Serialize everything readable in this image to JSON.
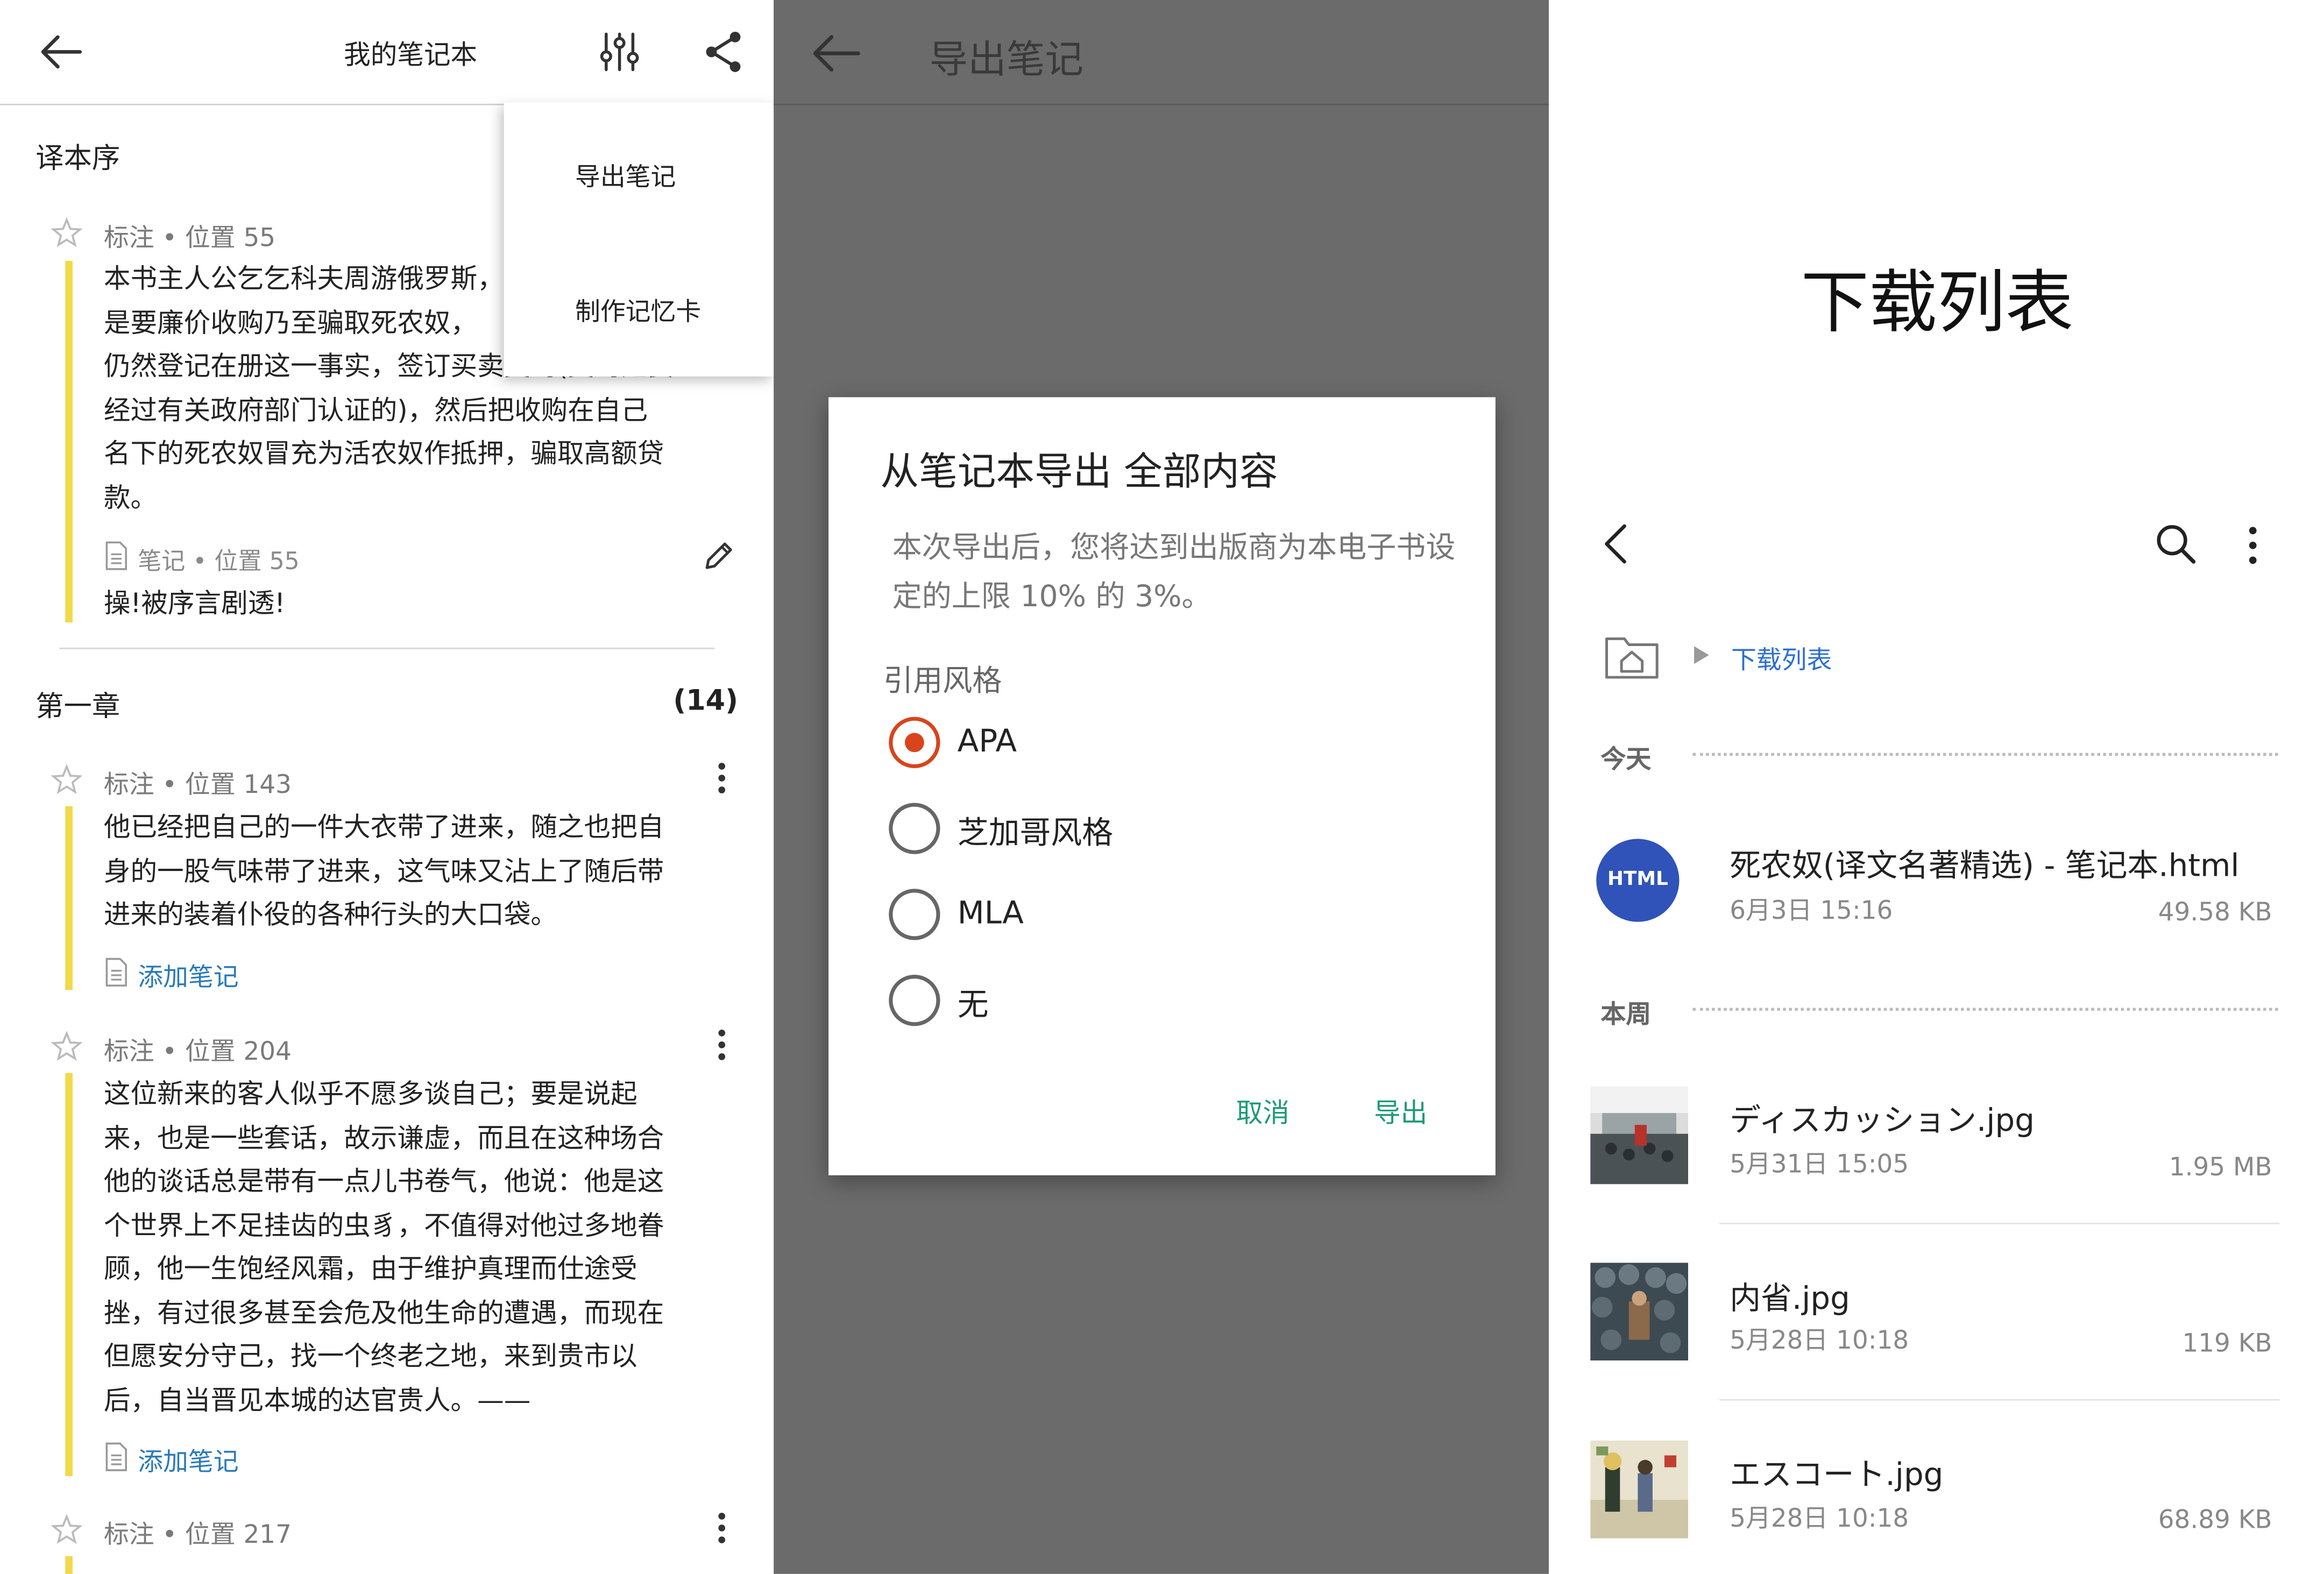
{
  "notebook": {
    "header": {
      "title": "我的笔记本",
      "icons": [
        "back-arrow-icon",
        "filter-sliders-icon",
        "share-icon"
      ]
    },
    "menu": {
      "items": [
        "导出笔记",
        "制作记忆卡"
      ]
    },
    "sections": [
      {
        "title": "译本序",
        "annotations": [
          {
            "meta": "标注 • 位置 55",
            "lines": [
              "本书主人公乞乞科夫周游俄罗斯，",
              "是要廉价收购乃至骗取死农奴，",
              "仍然登记在册这一事实，签订买卖契约(契约是要",
              "经过有关政府部门认证的)，然后把收购在自己",
              "名下的死农奴冒充为活农奴作抵押，骗取高额贷",
              "款。"
            ],
            "note_meta": "笔记 • 位置 55",
            "note_text": "操!被序言剧透!"
          }
        ]
      },
      {
        "title": "第一章",
        "count": "(14)",
        "annotations": [
          {
            "meta": "标注 • 位置 143",
            "lines": [
              "他已经把自己的一件大衣带了进来，随之也把自",
              "身的一股气味带了进来，这气味又沾上了随后带",
              "进来的装着仆役的各种行头的大口袋。"
            ],
            "add_note": "添加笔记"
          },
          {
            "meta": "标注 • 位置 204",
            "lines": [
              "这位新来的客人似乎不愿多谈自己；要是说起",
              "来，也是一些套话，故示谦虚，而且在这种场合",
              "他的谈话总是带有一点儿书卷气，他说：他是这",
              "个世界上不足挂齿的虫豸，不值得对他过多地眷",
              "顾，他一生饱经风霜，由于维护真理而仕途受",
              "挫，有过很多甚至会危及他生命的遭遇，而现在",
              "但愿安分守己，找一个终老之地，来到贵市以",
              "后，自当晋见本城的达官贵人。——"
            ],
            "add_note": "添加笔记"
          },
          {
            "meta": "标注 • 位置 217",
            "lines": [
              "……"
            ]
          }
        ]
      }
    ]
  },
  "export": {
    "header": {
      "title": "导出笔记"
    },
    "dialog": {
      "title": "从笔记本导出 全部内容",
      "body": "本次导出后，您将达到出版商为本电子书设定的上限 10% 的 3%。",
      "style_label": "引用风格",
      "options": [
        "APA",
        "芝加哥风格",
        "MLA",
        "无"
      ],
      "selected": "APA",
      "cancel": "取消",
      "confirm": "导出"
    },
    "accent_color": "#1e9a78",
    "radio_color": "#d9441c"
  },
  "downloads": {
    "title": "下载列表",
    "breadcrumb": "下载列表",
    "groups": [
      {
        "label": "今天",
        "files": [
          {
            "name": "死农奴(译文名著精选) - 笔记本.html",
            "date": "6月3日 15:16",
            "size": "49.58 KB",
            "icon": "HTML"
          }
        ]
      },
      {
        "label": "本周",
        "files": [
          {
            "name": "ディスカッション.jpg",
            "date": "5月31日 15:05",
            "size": "1.95 MB"
          },
          {
            "name": "内省.jpg",
            "date": "5月28日 10:18",
            "size": "119 KB"
          },
          {
            "name": "エスコート.jpg",
            "date": "5月28日 10:18",
            "size": "68.89 KB"
          }
        ]
      }
    ]
  }
}
